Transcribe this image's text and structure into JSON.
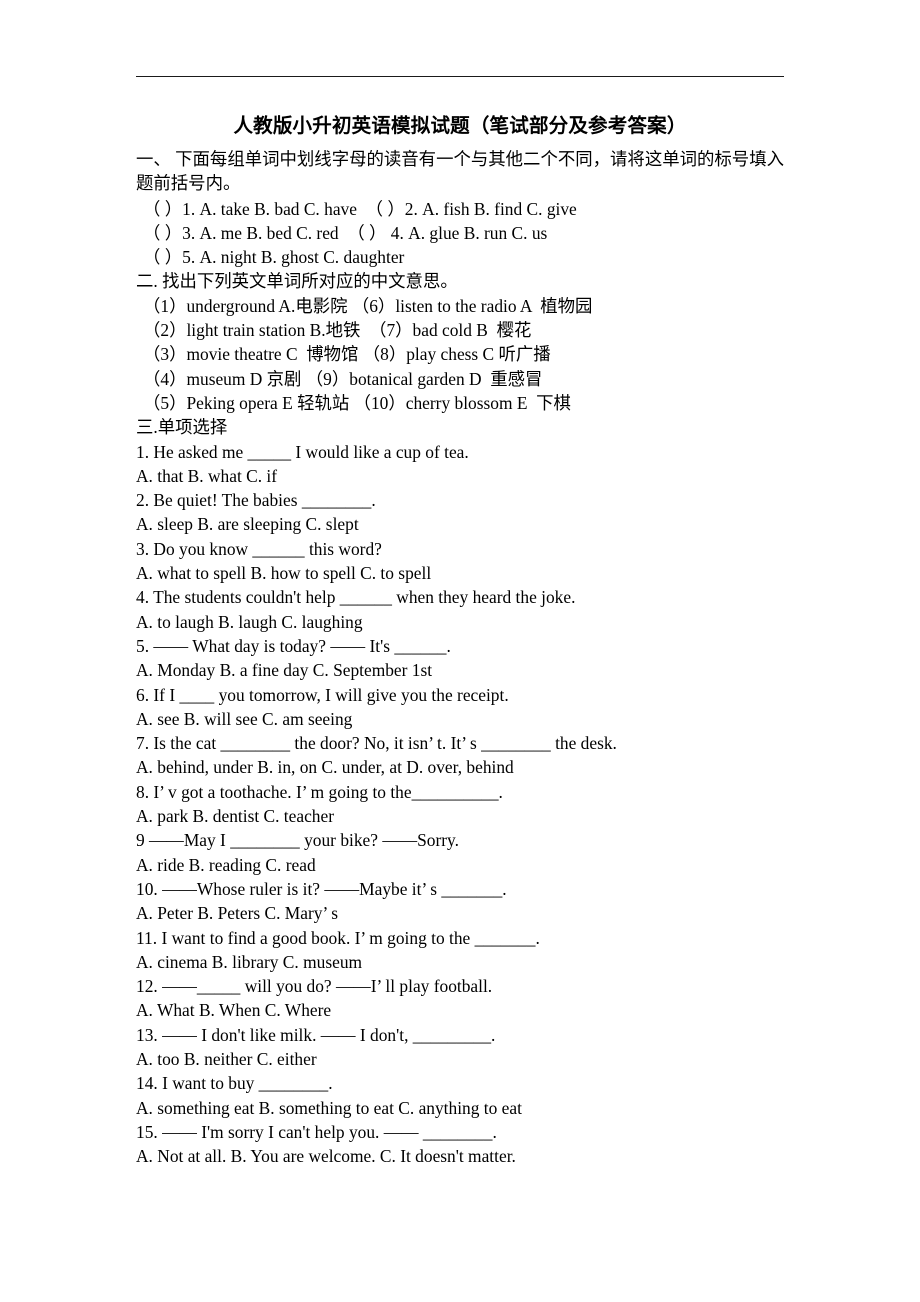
{
  "document": {
    "title": "人教版小升初英语模拟试题（笔试部分及参考答案）",
    "section_one": {
      "instruction": "一、 下面每组单词中划线字母的读音有一个与其他二个不同，请将这单词的标号填入题前括号内。",
      "items": [
        "（ ）1. A. take B. bad C. have  （ ）2. A. fish B. find C. give",
        "（ ）3. A. me B. bed C. red  （ ） 4. A. glue B. run C. us",
        "（ ）5. A. night B. ghost C. daughter"
      ]
    },
    "section_two": {
      "heading": "二. 找出下列英文单词所对应的中文意思。",
      "items": [
        "（1）underground A.电影院 （6）listen to the radio A  植物园",
        "（2）light train station B.地铁  （7）bad cold B  樱花",
        "（3）movie theatre C  博物馆 （8）play chess C 听广播",
        "（4）museum D 京剧 （9）botanical garden D  重感冒",
        "（5）Peking opera E 轻轨站 （10）cherry blossom E  下棋"
      ]
    },
    "section_three": {
      "heading": "三.单项选择",
      "questions": [
        {
          "stem": "1. He asked me _____ I would like a cup of tea.",
          "options": "A. that B. what C. if"
        },
        {
          "stem": "2. Be quiet! The babies ________.",
          "options": "A. sleep B. are sleeping C. slept"
        },
        {
          "stem": "3. Do you know ______ this word?",
          "options": "A. what to spell B. how to spell C. to spell"
        },
        {
          "stem": "4. The students couldn't help ______ when they heard the joke.",
          "options": "A. to laugh B. laugh C. laughing"
        },
        {
          "stem": "5. —— What day is today? —— It's ______.",
          "options": "A. Monday B. a fine day C. September 1st"
        },
        {
          "stem": "6. If I ____ you tomorrow, I will give you the receipt.",
          "options": "A. see B. will see C. am seeing"
        },
        {
          "stem": "7. Is the cat ________ the door? No, it isn’ t. It’ s ________ the desk.",
          "options": "A. behind, under B. in, on C. under, at D. over, behind"
        },
        {
          "stem": "8. I’ v got a toothache. I’ m going to the__________.",
          "options": "A. park B. dentist C. teacher"
        },
        {
          "stem": "9 ——May I ________ your bike? ——Sorry.",
          "options": "A. ride B. reading C. read"
        },
        {
          "stem": "10. ——Whose ruler is it? ——Maybe it’ s _______.",
          "options": "A. Peter B. Peters C. Mary’ s"
        },
        {
          "stem": "11. I want to find a good book. I’ m going to the _______.",
          "options": "A. cinema B. library C. museum"
        },
        {
          "stem": "12. ——_____ will you do? ——I’ ll play football.",
          "options": "A. What B. When C. Where"
        },
        {
          "stem": "13. —— I don't like milk. —— I don't, _________.",
          "options": "A. too B. neither C. either"
        },
        {
          "stem": "14. I want to buy ________.",
          "options": "A. something eat B. something to eat C. anything to eat"
        },
        {
          "stem": "15. —— I'm sorry I can't help you. —— ________.",
          "options": "A. Not at all. B. You are welcome. C. It doesn't matter."
        }
      ]
    }
  }
}
